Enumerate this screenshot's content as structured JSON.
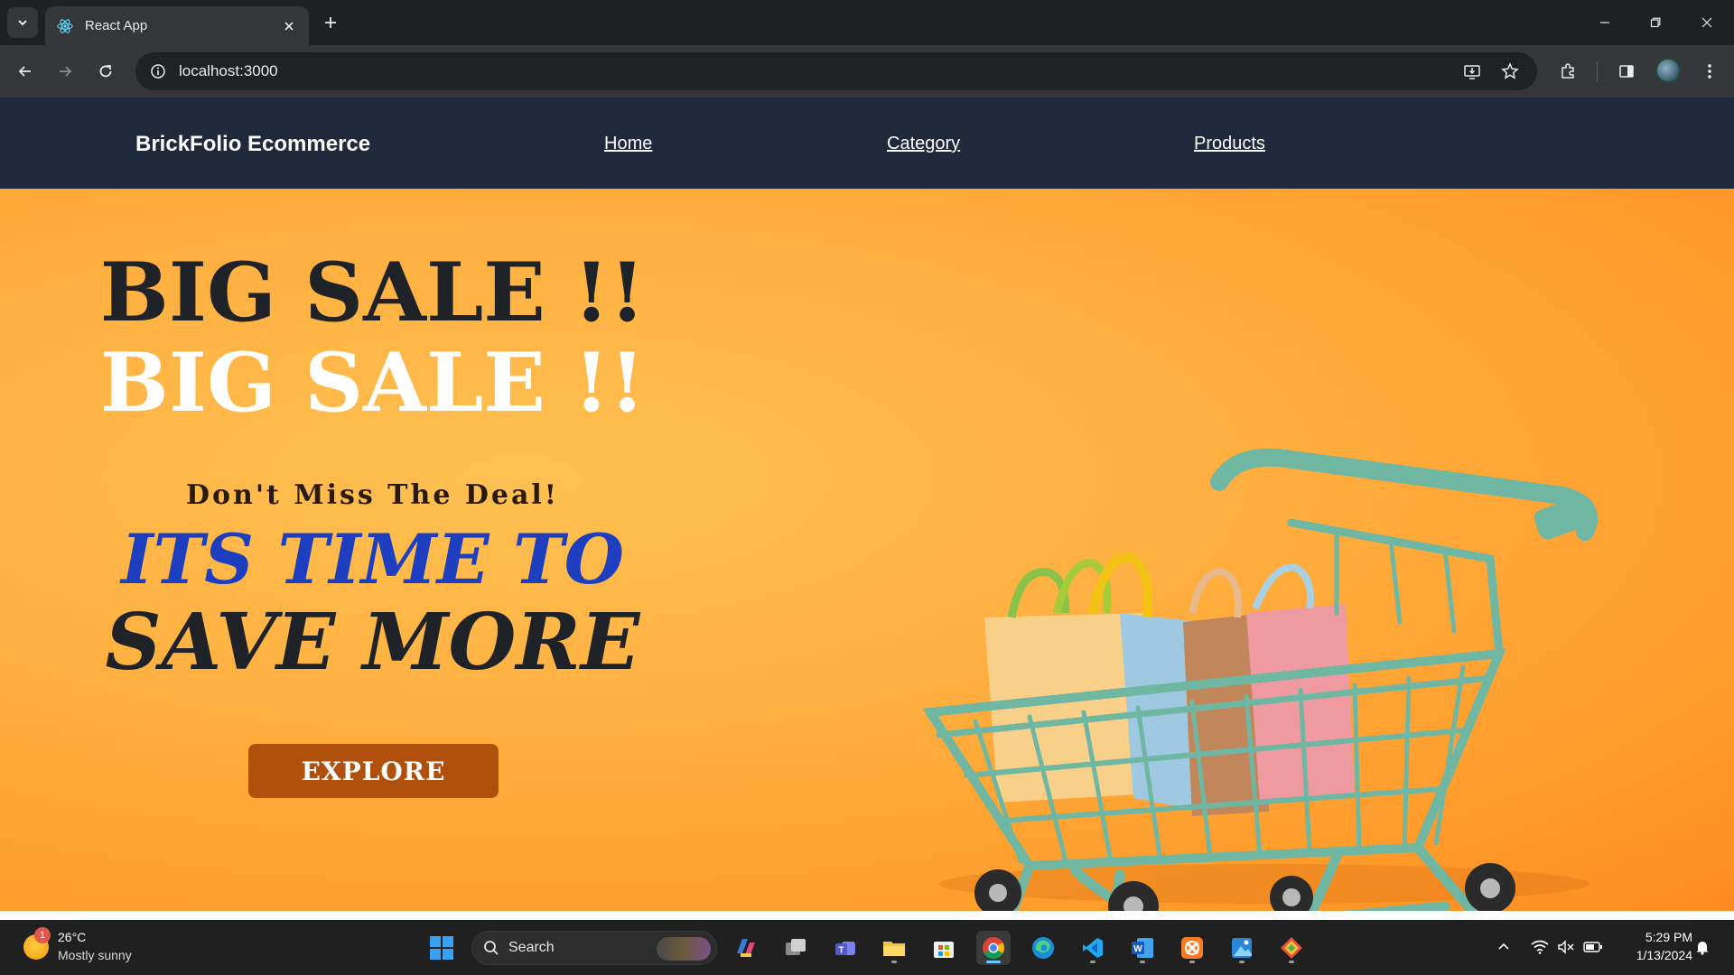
{
  "browser": {
    "tab_title": "React App",
    "url": "localhost:3000"
  },
  "site": {
    "brand": "BrickFolio Ecommerce",
    "nav": [
      "Home",
      "Category",
      "Products"
    ],
    "hero": {
      "headline_1": "BIG SALE !!",
      "headline_2": "BIG SALE !!",
      "tagline": "Don't Miss The Deal!",
      "line_blue": "ITS TIME TO",
      "line_dark": "SAVE MORE",
      "cta": "EXPLORE"
    },
    "colors": {
      "nav_bg": "#1e293b",
      "hero_bg": "#ffb040",
      "blue_text": "#1d3fbf",
      "cta_bg": "#b0500d"
    }
  },
  "taskbar": {
    "weather_badge": "1",
    "temperature": "26°C",
    "weather": "Mostly sunny",
    "search_placeholder": "Search",
    "time": "5:29 PM",
    "date": "1/13/2024"
  }
}
